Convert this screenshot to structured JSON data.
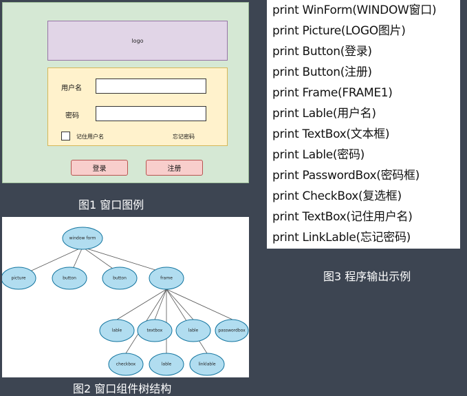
{
  "figure1": {
    "logo_text": "logo",
    "username_label": "用户名",
    "password_label": "密码",
    "remember_label": "记住用户名",
    "forgot_link": "忘记密码",
    "login_button": "登录",
    "register_button": "注册",
    "caption": "图1 窗口图例"
  },
  "figure2": {
    "caption": "图2 窗口组件树结构",
    "nodes": {
      "root": "window form",
      "picture": "picture",
      "button1": "button",
      "button2": "button",
      "frame": "frame",
      "lable1": "lable",
      "textbox": "textbox",
      "lable2": "lable",
      "passwordbox": "passwordbox",
      "checkbox": "checkbox",
      "lable3": "lable",
      "linklable": "linklable"
    }
  },
  "figure3": {
    "lines": [
      "print WinForm(WINDOW窗口)",
      "print Picture(LOGO图片)",
      "print Button(登录)",
      "print Button(注册)",
      "print Frame(FRAME1)",
      "print Lable(用户名)",
      "print TextBox(文本框)",
      "print Lable(密码)",
      "print PasswordBox(密码框)",
      "print CheckBox(复选框)",
      "print TextBox(记住用户名)",
      "print LinkLable(忘记密码)"
    ],
    "caption": "图3 程序输出示例"
  },
  "colors": {
    "background": "#3d4552",
    "window_fill": "#d5e8d4",
    "logo_fill": "#e1d5e7",
    "frame_fill": "#fff2cc",
    "button_fill": "#f8cecc",
    "node_fill": "#b1ddf0"
  }
}
